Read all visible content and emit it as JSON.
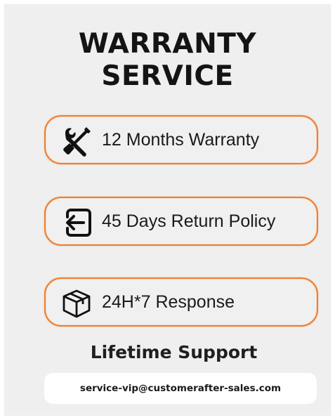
{
  "header": {
    "title_line1": "WARRANTY",
    "title_line2": "SERVICE"
  },
  "features": [
    {
      "label": "12 Months Warranty",
      "icon": "tools-icon"
    },
    {
      "label": "45 Days Return Policy",
      "icon": "return-arrow-icon"
    },
    {
      "label": "24H*7 Response",
      "icon": "package-box-icon"
    }
  ],
  "support": {
    "heading": "Lifetime Support",
    "email": "service-vip@customerafter-sales.com"
  },
  "colors": {
    "accent": "#f07d2e",
    "background": "#efefef",
    "text": "#1a1a1a"
  }
}
